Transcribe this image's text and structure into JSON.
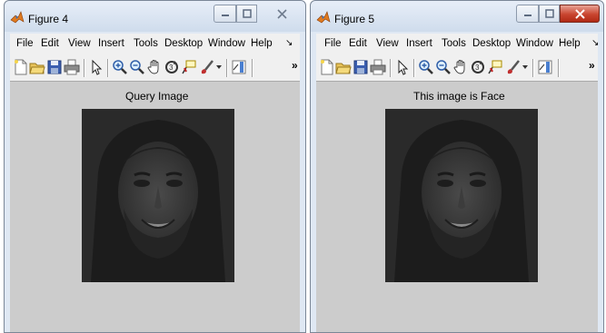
{
  "windows": [
    {
      "title": "Figure 4",
      "menu": [
        "File",
        "Edit",
        "View",
        "Insert",
        "Tools",
        "Desktop",
        "Window",
        "Help"
      ],
      "menu_more_glyph": "↘",
      "toolbar_more_glyph": "»",
      "axes_title": "Query Image",
      "active": false
    },
    {
      "title": "Figure 5",
      "menu": [
        "File",
        "Edit",
        "View",
        "Insert",
        "Tools",
        "Desktop",
        "Window",
        "Help"
      ],
      "menu_more_glyph": "↘",
      "toolbar_more_glyph": "»",
      "axes_title": "This image is Face",
      "active": true
    }
  ],
  "toolbar_icons": [
    "new-figure-icon",
    "open-file-icon",
    "save-figure-icon",
    "print-figure-icon",
    "edit-plot-arrow-icon",
    "zoom-in-icon",
    "zoom-out-icon",
    "pan-hand-icon",
    "rotate-3d-icon",
    "data-cursor-icon",
    "brush-icon",
    "insert-colorbar-icon"
  ],
  "colors": {
    "figure_bg": "#cccccc",
    "title_bar": "#dfe8f3",
    "close_active": "#c9452f"
  }
}
